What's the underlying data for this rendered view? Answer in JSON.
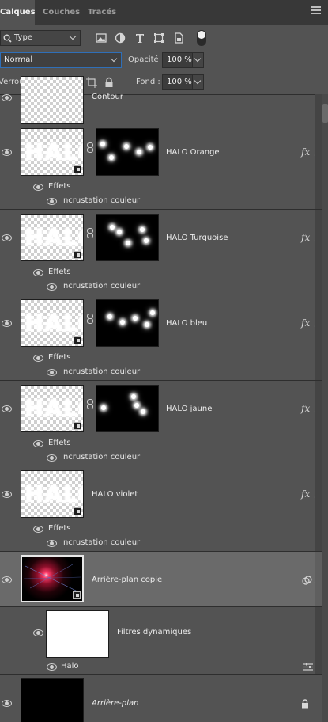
{
  "tabs": [
    {
      "label": "Calques",
      "active": true
    },
    {
      "label": "Couches",
      "active": false
    },
    {
      "label": "Tracés",
      "active": false
    }
  ],
  "filter": {
    "label": "Type",
    "icons": [
      "image-filter-icon",
      "adjustment-filter-icon",
      "type-filter-icon",
      "shape-filter-icon",
      "smart-object-filter-icon"
    ]
  },
  "blend": {
    "mode": "Normal",
    "opacity_label": "Opacité :",
    "opacity_value": "100 %"
  },
  "lock": {
    "label": "Verrou :",
    "fill_label": "Fond :",
    "fill_value": "100 %",
    "icons": [
      "lock-transparent-pixels-icon",
      "lock-image-pixels-icon",
      "lock-position-icon",
      "lock-artboard-icon",
      "lock-all-icon"
    ]
  },
  "layers": {
    "contour": {
      "name": "Contour"
    },
    "items": [
      {
        "name": "HALO Orange",
        "effects_label": "Effets",
        "effect": "Incrustation couleur",
        "fx": "fx"
      },
      {
        "name": "HALO Turquoise",
        "effects_label": "Effets",
        "effect": "Incrustation couleur",
        "fx": "fx"
      },
      {
        "name": "HALO bleu",
        "effects_label": "Effets",
        "effect": "Incrustation couleur",
        "fx": "fx"
      },
      {
        "name": "HALO jaune",
        "effects_label": "Effets",
        "effect": "Incrustation couleur",
        "fx": "fx"
      },
      {
        "name": "HALO violet",
        "effects_label": "Effets",
        "effect": "Incrustation couleur",
        "fx": "fx"
      }
    ],
    "thumb_text": "HALO",
    "copy": {
      "name": "Arrière-plan copie",
      "smart_filters_label": "Filtres dynamiques",
      "filter_name": "Halo"
    },
    "background": {
      "name": "Arrière-plan"
    }
  },
  "colors": {
    "panel": "#535353",
    "tabbar": "#383838",
    "selected": "#6a6a6a",
    "accent": "#2f6fb8"
  }
}
